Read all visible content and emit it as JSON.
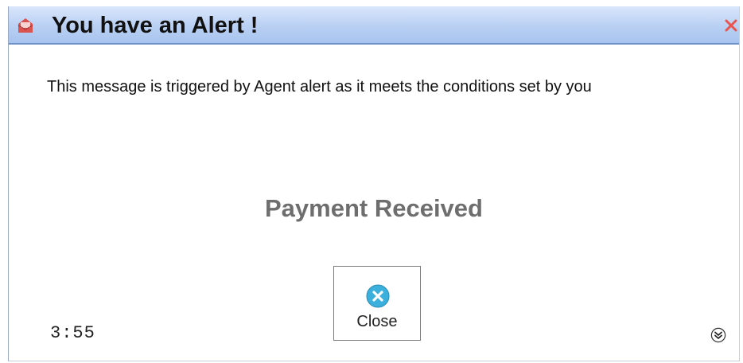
{
  "window": {
    "title": "You have an Alert !"
  },
  "body": {
    "message": "This message is triggered by Agent alert as it meets the conditions set by you",
    "headline": "Payment Received"
  },
  "buttons": {
    "close_label": "Close"
  },
  "footer": {
    "timer": "3:55"
  },
  "icons": {
    "title_icon": "alert-envelope-icon",
    "title_close": "close-x-icon",
    "close_button_icon": "close-circle-icon",
    "expand": "double-chevron-down-icon"
  },
  "colors": {
    "titlebar": "#b9d0f3",
    "title_close": "#e8554f",
    "close_icon": "#3bb0dc",
    "headline": "#6e6e6e"
  }
}
